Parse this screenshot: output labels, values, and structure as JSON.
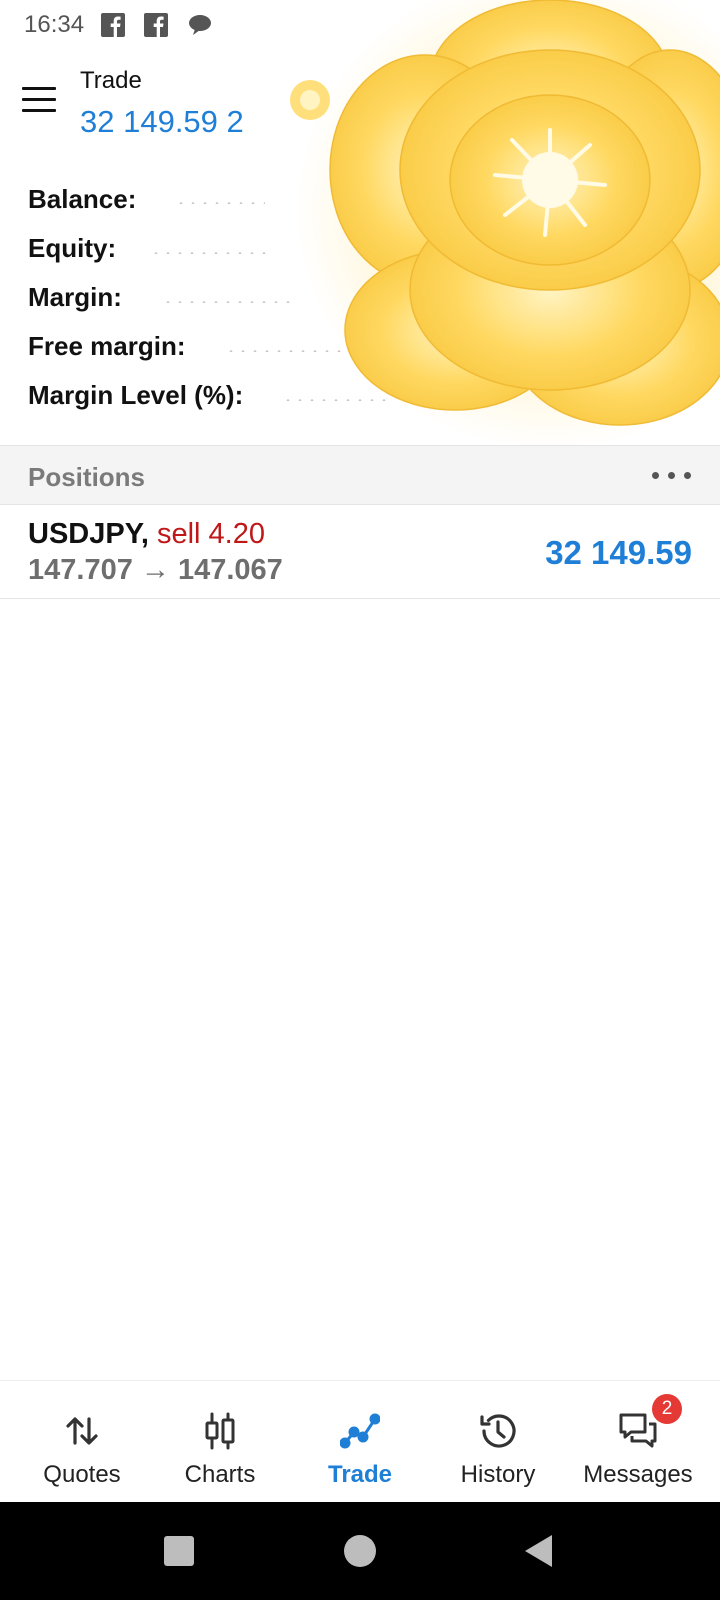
{
  "status_bar": {
    "time": "16:34",
    "icons": [
      "facebook-icon",
      "facebook-icon",
      "chat-bubble-icon"
    ]
  },
  "header": {
    "title": "Trade",
    "value": "32 149.59 2"
  },
  "account": {
    "balance_label": "Balance:",
    "equity_label": "Equity:",
    "margin_label": "Margin:",
    "free_margin_label": "Free margin:",
    "margin_level_label": "Margin Level (%):"
  },
  "positions": {
    "title": "Positions",
    "more_icon": "more-horizontal-icon",
    "items": [
      {
        "symbol": "USDJPY,",
        "side": "sell 4.20",
        "prices": "147.707 → 147.067",
        "profit": "32 149.59"
      }
    ]
  },
  "bottom_nav": {
    "items": [
      {
        "label": "Quotes",
        "icon": "arrows-updown-icon"
      },
      {
        "label": "Charts",
        "icon": "candlestick-icon"
      },
      {
        "label": "Trade",
        "icon": "trend-line-icon"
      },
      {
        "label": "History",
        "icon": "history-icon"
      },
      {
        "label": "Messages",
        "icon": "messages-icon",
        "badge": "2"
      }
    ],
    "active": "Trade"
  },
  "colors": {
    "accent": "#1f7fd6",
    "sell": "#c01818",
    "badge": "#e53935"
  }
}
